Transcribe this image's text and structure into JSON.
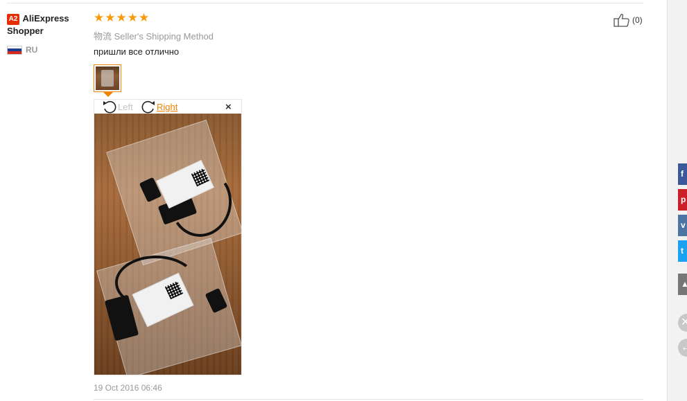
{
  "reviewer": {
    "badge": "A2",
    "name": "AliExpress Shopper",
    "country": "RU"
  },
  "rating": {
    "stars": 5,
    "max": 5,
    "star_glyph": "★"
  },
  "shipping": {
    "prefix": "物流",
    "method": "Seller's Shipping Method"
  },
  "review": {
    "text": "пришли все отлично",
    "date": "19 Oct 2016 06:46"
  },
  "helpful": {
    "count": "(0)",
    "icon": "thumbs-up-icon"
  },
  "image_viewer": {
    "rotate_left_label": "Left",
    "rotate_right_label": "Right",
    "close_glyph": "×"
  },
  "share_bar": {
    "facebook": "f",
    "pinterest": "p",
    "vk": "v",
    "twitter": "t",
    "scroll_up": "▲"
  },
  "colors": {
    "accent": "#f08200",
    "badge": "#e62e04",
    "star": "#f79b0c",
    "facebook": "#3b5998",
    "pinterest": "#cb2027",
    "vk": "#4c75a3",
    "twitter": "#1da1f2"
  }
}
